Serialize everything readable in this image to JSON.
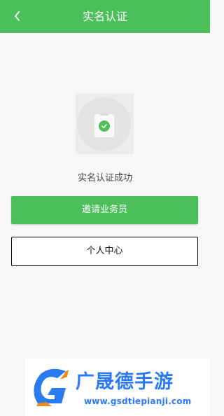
{
  "header": {
    "title": "实名认证",
    "back_icon": "chevron-left-icon"
  },
  "status": {
    "icon": "clipboard-check-icon",
    "message": "实名认证成功"
  },
  "actions": {
    "invite_label": "邀请业务员",
    "personal_center_label": "个人中心"
  },
  "watermark": {
    "brand": "广晟德手游",
    "url": "www.gsdtiepianji.com"
  },
  "colors": {
    "accent": "#4cbf5a",
    "brand_blue": "#2979ff"
  }
}
